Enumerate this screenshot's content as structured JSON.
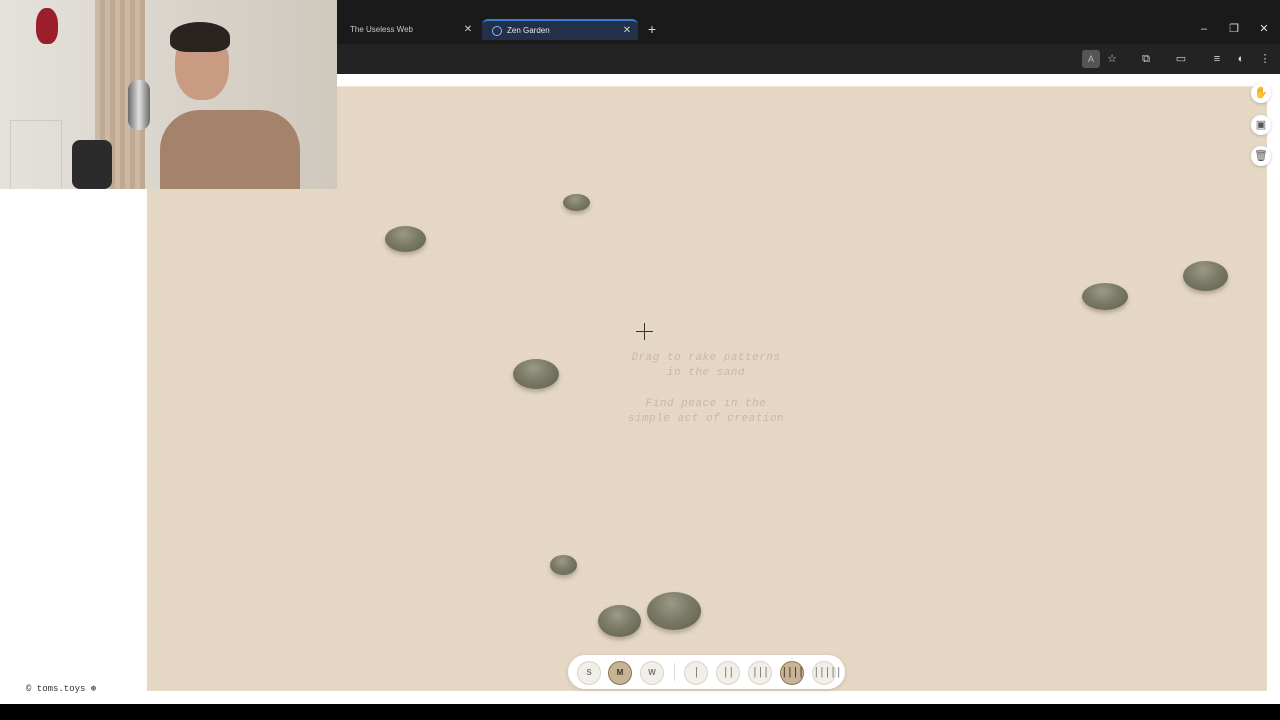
{
  "browser": {
    "tabs": [
      {
        "label": "The Useless Web",
        "active": false
      },
      {
        "label": "Zen Garden",
        "active": true
      }
    ],
    "new_tab_symbol": "+",
    "window_controls": {
      "minimize": "–",
      "restore": "❐",
      "close": "✕"
    },
    "toolbar_icons": [
      "translate-icon",
      "star-icon",
      "extensions-icon",
      "cast-icon",
      "media-icon",
      "profile-icon",
      "menu-icon"
    ]
  },
  "garden": {
    "hint_lines": [
      "Drag to rake patterns",
      "in the sand",
      "Find peace in the",
      "simple act of creation"
    ],
    "stones": [
      {
        "id": "s1"
      },
      {
        "id": "s2"
      },
      {
        "id": "s3"
      },
      {
        "id": "s4"
      },
      {
        "id": "s5"
      },
      {
        "id": "s6"
      },
      {
        "id": "s7"
      },
      {
        "id": "s8"
      }
    ],
    "size_controls": [
      {
        "label": "S",
        "selected": false
      },
      {
        "label": "M",
        "selected": true
      },
      {
        "label": "W",
        "selected": false
      }
    ],
    "rake_controls": [
      {
        "label": "|",
        "selected": false
      },
      {
        "label": "||",
        "selected": false
      },
      {
        "label": "|||",
        "selected": false
      },
      {
        "label": "||||",
        "selected": true
      },
      {
        "label": "|||||",
        "selected": false
      }
    ],
    "side_icons": [
      "hand-icon",
      "save-icon",
      "trash-icon"
    ],
    "colors": {
      "sand": "#e5d7c3",
      "stone": "#7a7a66",
      "selected": "#c7b395"
    }
  },
  "footer": {
    "text": "© toms.toys ⊛"
  }
}
